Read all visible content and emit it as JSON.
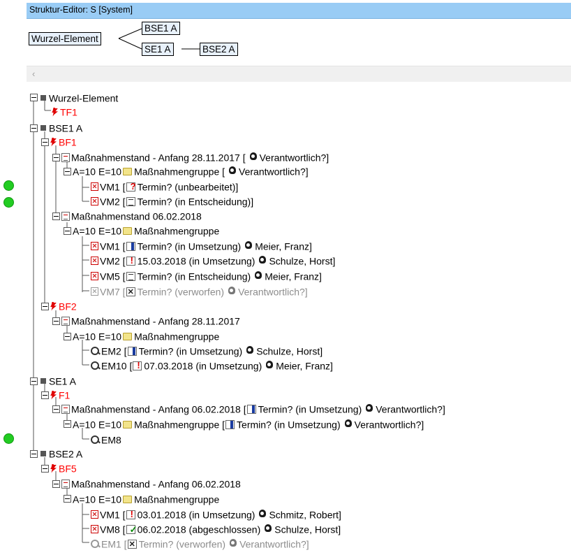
{
  "window": {
    "title": "Struktur-Editor: S [System]"
  },
  "structure_view": {
    "root": "Wurzel-Element",
    "bse1": "BSE1 A",
    "se1": "SE1 A",
    "bse2": "BSE2 A"
  },
  "scrollbar": {
    "left_arrow": "‹"
  },
  "tree": {
    "n0": "Wurzel-Element",
    "n1": "TF1",
    "n2": "BSE1 A",
    "n3": "BF1",
    "n4": "Maßnahmenstand - Anfang 28.11.2017 [",
    "n4b": "Verantwortlich?]",
    "n5": "A=10 E=10",
    "n5b": "Maßnahmengruppe [",
    "n5c": "Verantwortlich?]",
    "n6": "VM1 [",
    "n6b": "Termin? (unbearbeitet)]",
    "n7": "VM2 [",
    "n7b": "Termin? (in Entscheidung)]",
    "n8": "Maßnahmenstand 06.02.2018",
    "n9": "A=10 E=10",
    "n9b": "Maßnahmengruppe",
    "n10": "VM1 [",
    "n10b": "Termin? (in Umsetzung)",
    "n10c": "Meier, Franz]",
    "n11": "VM2 [",
    "n11b": "15.03.2018 (in Umsetzung)",
    "n11c": "Schulze, Horst]",
    "n12": "VM5 [",
    "n12b": "Termin? (in Entscheidung)",
    "n12c": "Meier, Franz]",
    "n13": "VM7 [",
    "n13b": "Termin? (verworfen)",
    "n13c": "Verantwortlich?]",
    "n14": "BF2",
    "n15": "Maßnahmenstand - Anfang 28.11.2017",
    "n16": "A=10 E=10",
    "n16b": "Maßnahmengruppe",
    "n17": "EM2 [",
    "n17b": "Termin? (in Umsetzung)",
    "n17c": "Schulze, Horst]",
    "n18": "EM10 [",
    "n18b": "07.03.2018 (in Umsetzung)",
    "n18c": "Meier, Franz]",
    "n19": "SE1 A",
    "n20": "F1",
    "n21": "Maßnahmenstand - Anfang 06.02.2018 [",
    "n21b": "Termin? (in Umsetzung)",
    "n21c": "Verantwortlich?]",
    "n22": "A=10 E=10",
    "n22b": "Maßnahmengruppe [",
    "n22c": "Termin? (in Umsetzung)",
    "n22d": "Verantwortlich?]",
    "n23": "EM8",
    "n24": "BSE2 A",
    "n25": "BF5",
    "n26": "Maßnahmenstand - Anfang 06.02.2018",
    "n27": "A=10 E=10",
    "n27b": "Maßnahmengruppe",
    "n28": "VM1 [",
    "n28b": "03.01.2018 (in Umsetzung)",
    "n28c": "Schmitz, Robert]",
    "n29": "VM8 [",
    "n29b": "06.02.2018 (abgeschlossen)",
    "n29c": "Schulze, Horst]",
    "n30": "EM1 [",
    "n30b": "Termin? (verworfen)",
    "n30c": "Verantwortlich?]"
  },
  "colors": {
    "red_function": "#ff0000",
    "gray_rejected": "#8c8c8c",
    "status_ok": "#22cc22"
  }
}
